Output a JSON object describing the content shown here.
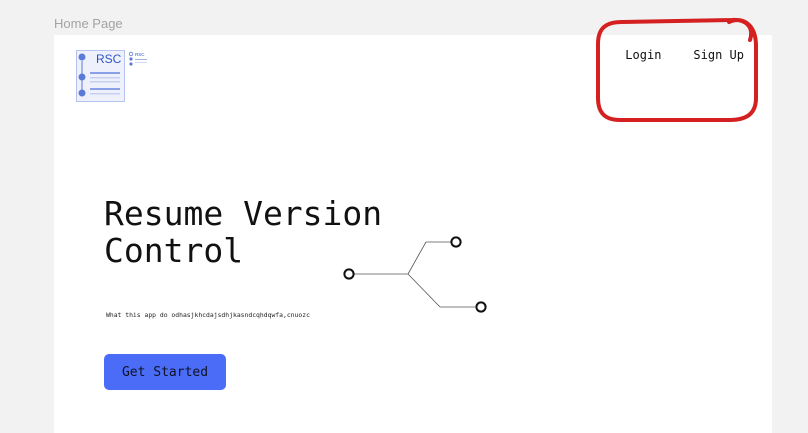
{
  "canvas": {
    "frame_label": "Home Page"
  },
  "header": {
    "logo_text": "RSC",
    "logo_small_text": "RSC",
    "nav": [
      {
        "label": "Login"
      },
      {
        "label": "Sign Up"
      }
    ]
  },
  "hero": {
    "title_line1": "Resume Version",
    "title_line2": "Control",
    "description": "What this app do odhasjkhcdajsdhjkasndcqhdqwfa,cnuozc",
    "cta_label": "Get Started"
  },
  "colors": {
    "accent": "#4a6cf7",
    "annotation": "#d42020",
    "canvas_bg": "#f2f2f2",
    "frame_bg": "#ffffff"
  }
}
